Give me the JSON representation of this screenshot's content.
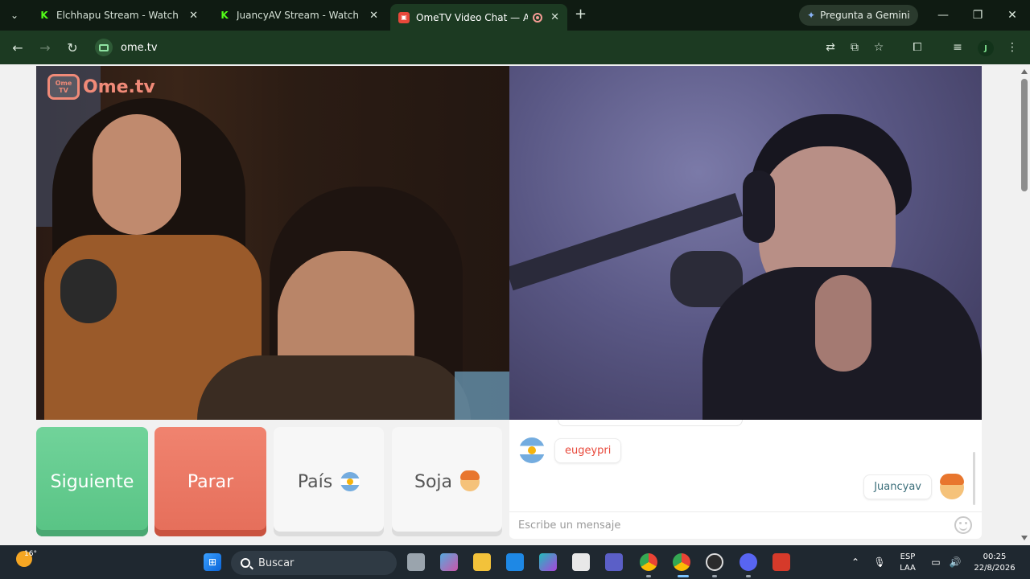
{
  "browser": {
    "tabs": [
      {
        "title": "Elchhapu Stream - Watch Live o",
        "favicon": "kick-icon",
        "active": false
      },
      {
        "title": "JuancyAV Stream - Watch Live o",
        "favicon": "kick-icon",
        "active": false
      },
      {
        "title": "OmeTV Video Chat — Alter",
        "favicon": "ometv-icon",
        "active": true,
        "recording": true
      }
    ],
    "gemini_label": "Pregunta a Gemini",
    "url": "ome.tv",
    "profile_initial": "J"
  },
  "ometv": {
    "logo_badge": "Ome TV",
    "logo_text": "Ome.tv",
    "buttons": {
      "next": "Siguiente",
      "stop": "Parar",
      "country": "País",
      "gender": "Soja"
    },
    "chat": {
      "messages": [
        {
          "sender": "them",
          "text": "eugeypri",
          "avatar": "argentina-flag-icon"
        },
        {
          "sender": "me",
          "text": "Juancyav",
          "avatar": "boy-emoji-icon"
        }
      ],
      "input_placeholder": "Escribe un mensaje"
    }
  },
  "taskbar": {
    "weather_temp": "16°",
    "search_label": "Buscar",
    "language": "ESP",
    "layout": "LAA",
    "time": "00:25",
    "date": "22/8/2026"
  },
  "colors": {
    "accent_green": "#58c384",
    "stop_red": "#e56e5a",
    "chrome_dark": "#1c3a22"
  }
}
